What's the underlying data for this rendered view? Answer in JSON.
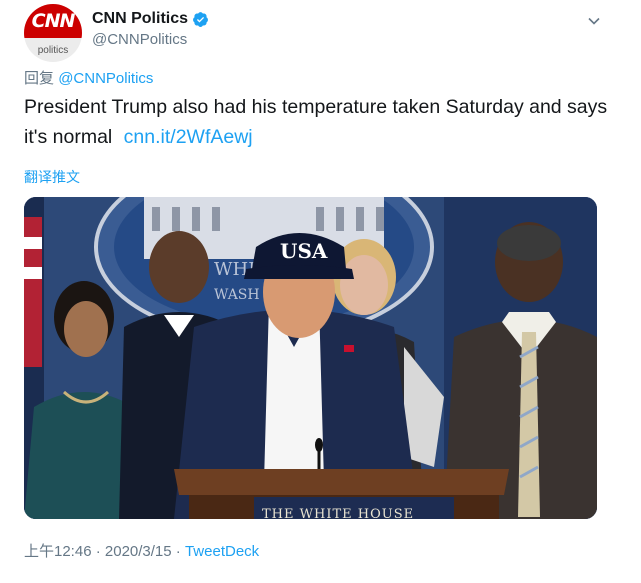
{
  "account": {
    "display_name": "CNN Politics",
    "handle": "@CNNPolitics",
    "avatar_logo_text": "CNN",
    "avatar_sub_text": "politics"
  },
  "reply": {
    "prefix": "回复",
    "mention": "@CNNPolitics"
  },
  "tweet": {
    "text": "President Trump also had his temperature taken Saturday and says it's normal",
    "link": "cnn.it/2WfAewj",
    "translate_label": "翻译推文"
  },
  "photo": {
    "cap_text": "USA",
    "seal_text_1": "WHI",
    "seal_text_2": "WASH",
    "podium_text": "THE WHITE HOUSE"
  },
  "meta": {
    "time": "上午12:46",
    "date": "2020/3/15",
    "separator": "·",
    "source": "TweetDeck"
  },
  "colors": {
    "link_blue": "#1da1f2",
    "secondary_gray": "#657786",
    "cnn_red": "#cc0000"
  }
}
